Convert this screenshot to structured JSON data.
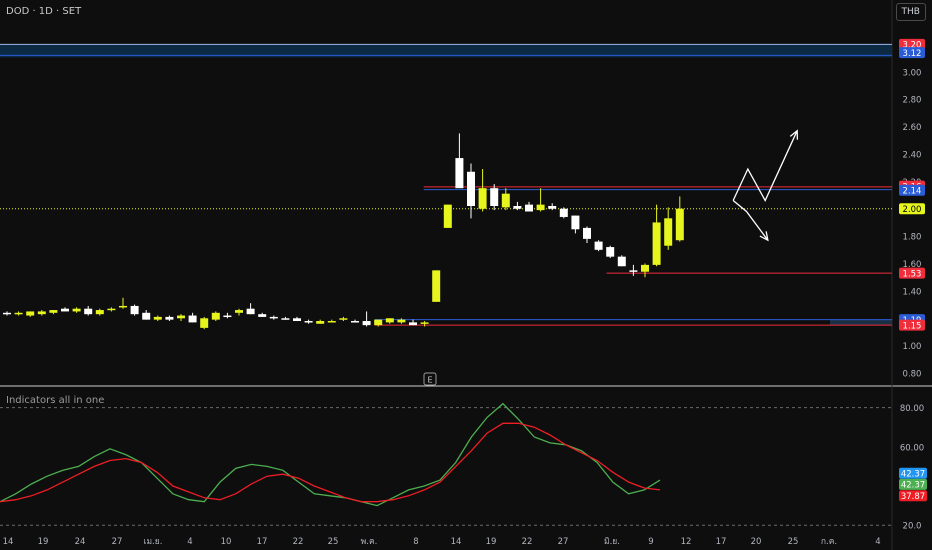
{
  "header": {
    "symbol": "DOD · 1D · SET",
    "currency": "THB"
  },
  "indicator": {
    "title": "Indicators all in one",
    "earnings_marker": "E"
  },
  "colors": {
    "bg": "#0e0e0e",
    "bull": "#e6f51d",
    "bear": "#ffffff",
    "green_line": "#4caf50",
    "red_line": "#ef1d24",
    "blue_level": "#2a5cd6",
    "red_level": "#ef2d3b",
    "yellow_label": "#e6f51d"
  },
  "chart_data": [
    {
      "type": "candlestick",
      "ylim": [
        0.72,
        3.32
      ],
      "y_ticks": [
        "3.00",
        "2.80",
        "2.60",
        "2.40",
        "2.20",
        "1.80",
        "1.60",
        "1.40",
        "1.00",
        "0.80"
      ],
      "y_tick_values": [
        3.0,
        2.8,
        2.6,
        2.4,
        2.2,
        1.8,
        1.6,
        1.4,
        1.0,
        0.8
      ],
      "x_ticks": [
        "14",
        "19",
        "24",
        "27",
        "เม.ย.",
        "4",
        "10",
        "17",
        "22",
        "25",
        "พ.ค.",
        "8",
        "14",
        "19",
        "22",
        "27",
        "มิ.ย.",
        "9",
        "12",
        "17",
        "20",
        "25",
        "ก.ค.",
        "4"
      ],
      "price_labels": [
        {
          "text": "3.20",
          "value": 3.2,
          "color": "#ef2d3b"
        },
        {
          "text": "3.12",
          "value": 3.14,
          "color": "#2a5cd6"
        },
        {
          "text": "2.16",
          "value": 2.165,
          "color": "#ef2d3b"
        },
        {
          "text": "2.14",
          "value": 2.135,
          "color": "#2a5cd6"
        },
        {
          "text": "2.00",
          "value": 2.0,
          "color": "#e6f51d"
        },
        {
          "text": "1.53",
          "value": 1.53,
          "color": "#ef2d3b"
        },
        {
          "text": "1.19",
          "value": 1.19,
          "color": "#2a5cd6"
        },
        {
          "text": "1.15",
          "value": 1.15,
          "color": "#ef2d3b"
        }
      ],
      "levels": [
        {
          "value": 3.2,
          "color": "#9fb7e8",
          "from": 0
        },
        {
          "value": 3.12,
          "color": "#2a5cd6",
          "from": 0
        },
        {
          "value": 2.16,
          "color": "#ef2d3b",
          "from": 0.475
        },
        {
          "value": 2.14,
          "color": "#2a5cd6",
          "from": 0.475
        },
        {
          "value": 1.53,
          "color": "#ef2d3b",
          "from": 0.68
        },
        {
          "value": 1.19,
          "color": "#2a5cd6",
          "from": 0.42
        },
        {
          "value": 1.15,
          "color": "#ef2d3b",
          "from": 0.42
        }
      ],
      "current_price": 2.0,
      "candles": [
        [
          1.24,
          1.25,
          1.22,
          1.23
        ],
        [
          1.23,
          1.25,
          1.22,
          1.24
        ],
        [
          1.22,
          1.25,
          1.21,
          1.25
        ],
        [
          1.23,
          1.26,
          1.22,
          1.25
        ],
        [
          1.24,
          1.26,
          1.23,
          1.26
        ],
        [
          1.27,
          1.28,
          1.25,
          1.25
        ],
        [
          1.25,
          1.28,
          1.24,
          1.27
        ],
        [
          1.27,
          1.29,
          1.22,
          1.23
        ],
        [
          1.23,
          1.27,
          1.22,
          1.26
        ],
        [
          1.26,
          1.28,
          1.25,
          1.27
        ],
        [
          1.28,
          1.35,
          1.27,
          1.29
        ],
        [
          1.29,
          1.3,
          1.22,
          1.23
        ],
        [
          1.24,
          1.26,
          1.19,
          1.19
        ],
        [
          1.19,
          1.22,
          1.18,
          1.21
        ],
        [
          1.21,
          1.22,
          1.18,
          1.19
        ],
        [
          1.2,
          1.23,
          1.18,
          1.22
        ],
        [
          1.22,
          1.24,
          1.17,
          1.17
        ],
        [
          1.13,
          1.21,
          1.12,
          1.2
        ],
        [
          1.19,
          1.25,
          1.18,
          1.24
        ],
        [
          1.22,
          1.24,
          1.2,
          1.21
        ],
        [
          1.24,
          1.27,
          1.22,
          1.26
        ],
        [
          1.27,
          1.31,
          1.23,
          1.23
        ],
        [
          1.23,
          1.24,
          1.21,
          1.21
        ],
        [
          1.21,
          1.22,
          1.19,
          1.2
        ],
        [
          1.2,
          1.21,
          1.19,
          1.19
        ],
        [
          1.2,
          1.21,
          1.18,
          1.18
        ],
        [
          1.18,
          1.19,
          1.16,
          1.17
        ],
        [
          1.16,
          1.19,
          1.16,
          1.18
        ],
        [
          1.18,
          1.19,
          1.17,
          1.18
        ],
        [
          1.19,
          1.21,
          1.18,
          1.2
        ],
        [
          1.18,
          1.19,
          1.17,
          1.17
        ],
        [
          1.18,
          1.25,
          1.14,
          1.15
        ],
        [
          1.15,
          1.19,
          1.14,
          1.19
        ],
        [
          1.17,
          1.2,
          1.16,
          1.2
        ],
        [
          1.17,
          1.2,
          1.16,
          1.19
        ],
        [
          1.17,
          1.19,
          1.15,
          1.15
        ],
        [
          1.16,
          1.18,
          1.14,
          1.17
        ],
        [
          1.32,
          1.55,
          1.32,
          1.55
        ],
        [
          1.86,
          2.03,
          1.86,
          2.03
        ],
        [
          2.37,
          2.55,
          2.19,
          2.15
        ],
        [
          2.27,
          2.33,
          1.93,
          2.02
        ],
        [
          2.0,
          2.29,
          1.98,
          2.15
        ],
        [
          2.15,
          2.18,
          1.99,
          2.02
        ],
        [
          2.01,
          2.15,
          1.99,
          2.11
        ],
        [
          2.02,
          2.05,
          1.99,
          2.0
        ],
        [
          2.03,
          2.05,
          1.98,
          1.98
        ],
        [
          1.99,
          2.15,
          1.98,
          2.03
        ],
        [
          2.02,
          2.04,
          1.99,
          2.0
        ],
        [
          2.0,
          2.01,
          1.93,
          1.94
        ],
        [
          1.95,
          1.95,
          1.82,
          1.85
        ],
        [
          1.86,
          1.87,
          1.75,
          1.78
        ],
        [
          1.76,
          1.77,
          1.69,
          1.7
        ],
        [
          1.72,
          1.73,
          1.64,
          1.65
        ],
        [
          1.65,
          1.66,
          1.58,
          1.58
        ],
        [
          1.55,
          1.59,
          1.51,
          1.54
        ],
        [
          1.54,
          1.6,
          1.5,
          1.59
        ],
        [
          1.59,
          2.03,
          1.58,
          1.9
        ],
        [
          1.73,
          2.01,
          1.7,
          1.93
        ],
        [
          1.77,
          2.09,
          1.76,
          2.0
        ]
      ],
      "arrows": [
        {
          "points": [
            [
              2.0,
              2.06
            ],
            [
              2.55,
              2.29
            ],
            [
              3.2,
              2.06
            ],
            [
              4.4,
              2.57
            ]
          ]
        },
        {
          "points": [
            [
              2.0,
              2.06
            ],
            [
              2.5,
              1.98
            ],
            [
              3.3,
              1.77
            ]
          ]
        }
      ]
    },
    {
      "type": "line",
      "title": "Indicators all in one",
      "ylim": [
        15,
        90
      ],
      "y_ticks": [
        "80.00",
        "60.00",
        "20.0"
      ],
      "y_tick_values": [
        80,
        60,
        20
      ],
      "dashed_levels": [
        80,
        20
      ],
      "series": [
        {
          "color": "#4caf50",
          "values": [
            32,
            36,
            41,
            45,
            48,
            50,
            55,
            59,
            56,
            52,
            44,
            36,
            33,
            32,
            42,
            49,
            51,
            50,
            48,
            42,
            36,
            35,
            34,
            32,
            30,
            34,
            38,
            40,
            43,
            52,
            65,
            75,
            82,
            74,
            65,
            62,
            61,
            58,
            52,
            42,
            36,
            38,
            43
          ]
        },
        {
          "color": "#ef1d24",
          "values": [
            32,
            33,
            35,
            38,
            42,
            46,
            50,
            53,
            54,
            52,
            47,
            40,
            37,
            34,
            33,
            36,
            41,
            45,
            46,
            44,
            40,
            37,
            34,
            32,
            32,
            33,
            35,
            38,
            42,
            50,
            58,
            67,
            72,
            72,
            70,
            66,
            61,
            57,
            53,
            47,
            42,
            39,
            38
          ]
        }
      ],
      "value_labels": [
        {
          "text": "42.37",
          "value": 46.5,
          "color": "#2196f3"
        },
        {
          "text": "42.37",
          "value": 40.8,
          "color": "#4caf50"
        },
        {
          "text": "37.87",
          "value": 35.0,
          "color": "#ef1d24"
        }
      ]
    }
  ]
}
